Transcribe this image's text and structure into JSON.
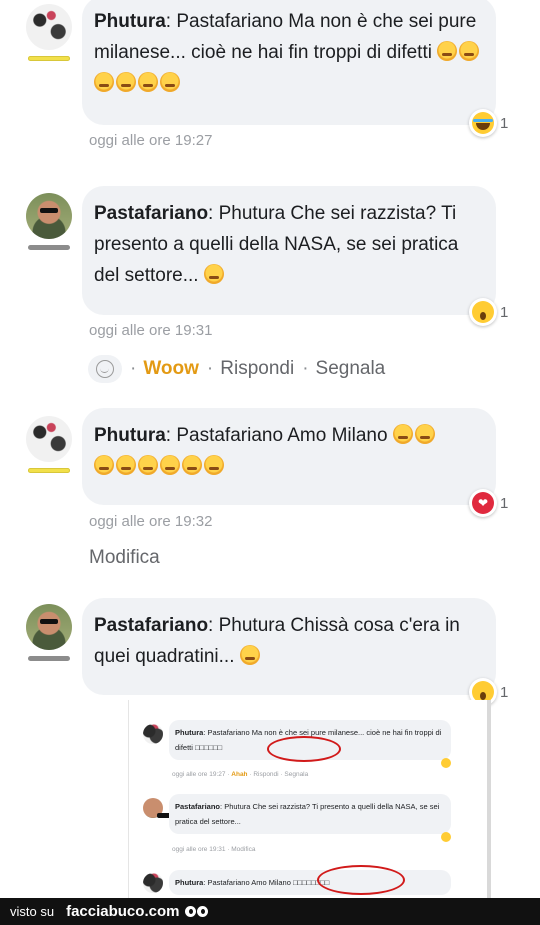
{
  "comments": [
    {
      "author": "Phutura",
      "text": ": Pastafariano Ma non è che sei pure milanese... cioè ne hai fin troppi di difetti",
      "time": "oggi alle ore 19:27",
      "reaction": {
        "type": "laugh-icon",
        "count": "1"
      },
      "emoji_count": 6
    },
    {
      "author": "Pastafariano",
      "text": ": Phutura Che sei razzista? Ti presento a quelli della NASA, se sei pratica del settore...",
      "time": "oggi alle ore 19:31",
      "reaction": {
        "type": "wow-icon",
        "count": "1"
      }
    },
    {
      "author": "Phutura",
      "text": ": Pastafariano Amo Milano",
      "time": "oggi alle ore 19:32",
      "reaction": {
        "type": "heart-icon",
        "count": "1"
      }
    },
    {
      "author": "Pastafariano",
      "text": ": Phutura Chissà cosa c'era in quei quadratini...",
      "reaction": {
        "type": "wow-icon",
        "count": "1"
      }
    }
  ],
  "actions": {
    "reaction_label": "Woow",
    "reply_label": "Rispondi",
    "report_label": "Segnala",
    "separator": "·"
  },
  "modifica_label": "Modifica",
  "embedded": {
    "c1_author": "Phutura",
    "c1_text": ": Pastafariano Ma non è che sei pure milanese... cioè ne hai fin troppi di difetti",
    "c1_boxes": "□□□□□□",
    "c1_meta_time": "oggi alle ore 19:27 ·",
    "c1_meta_ahah": "Ahah",
    "c1_meta_rest": "· Rispondi · Segnala",
    "c2_author": "Pastafariano",
    "c2_text": ": Phutura Che sei razzista? Ti presento a quelli della NASA, se sei pratica del settore...",
    "c2_meta": "oggi alle ore 19:31 · Modifica",
    "c3_author": "Phutura",
    "c3_text": ": Pastafariano Amo Milano",
    "c3_boxes": "□□□□□□□□"
  },
  "footer": {
    "visto_su": "visto su",
    "brand": "facciabuco.com"
  }
}
